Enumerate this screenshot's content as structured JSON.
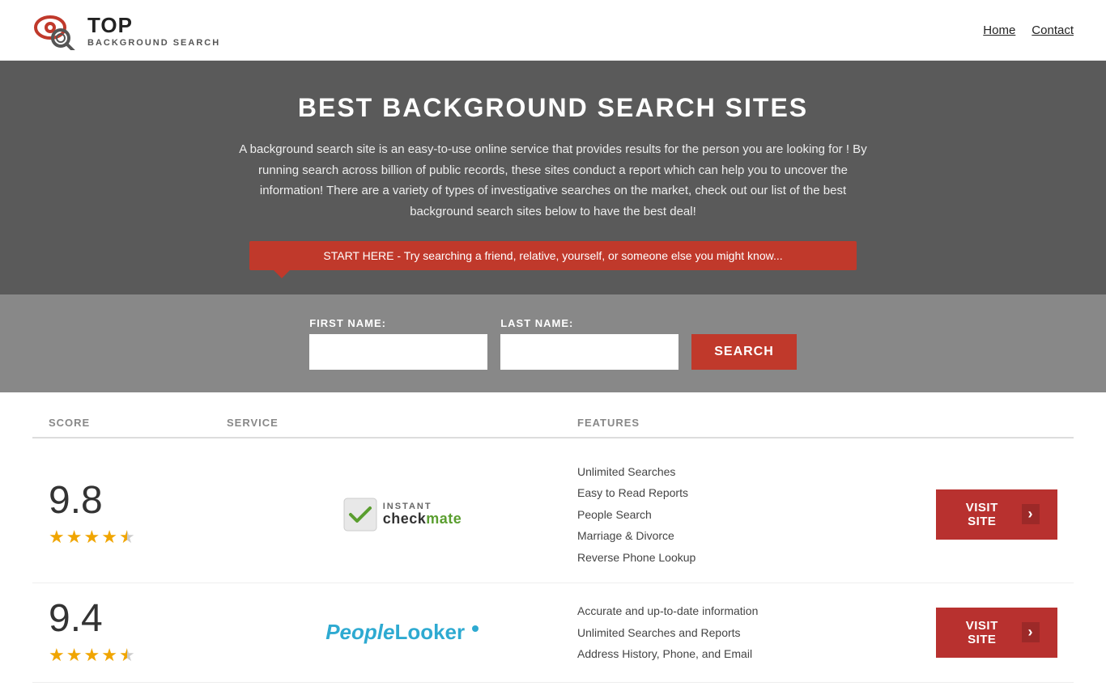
{
  "header": {
    "logo_top": "TOP",
    "logo_sub": "BACKGROUND SEARCH",
    "nav": [
      {
        "label": "Home",
        "href": "#"
      },
      {
        "label": "Contact",
        "href": "#"
      }
    ]
  },
  "hero": {
    "title": "BEST BACKGROUND SEARCH SITES",
    "description": "A background search site is an easy-to-use online service that provides results  for the person you are looking for ! By  running  search across billion of public records, these sites conduct  a report which can help you to uncover the information! There are a variety of types of investigative searches on the market, check out our  list of the best background search sites below to have the best deal!",
    "search_banner": "START HERE - Try searching a friend, relative, yourself, or someone else you might know..."
  },
  "search_form": {
    "first_name_label": "FIRST NAME:",
    "last_name_label": "LAST NAME:",
    "button_label": "SEARCH",
    "first_name_placeholder": "",
    "last_name_placeholder": ""
  },
  "table": {
    "headers": {
      "score": "SCORE",
      "service": "SERVICE",
      "features": "FEATURES",
      "action": ""
    },
    "rows": [
      {
        "score": "9.8",
        "stars": 4.5,
        "service_name": "instantcheckmate",
        "service_display": "instant checkmate",
        "features": [
          "Unlimited Searches",
          "Easy to Read Reports",
          "People Search",
          "Marriage & Divorce",
          "Reverse Phone Lookup"
        ],
        "visit_label": "VISIT SITE"
      },
      {
        "score": "9.4",
        "stars": 4.5,
        "service_name": "peoplelooker",
        "service_display": "PeopleLooker",
        "features": [
          "Accurate and up-to-date information",
          "Unlimited Searches and Reports",
          "Address History, Phone, and Email"
        ],
        "visit_label": "VISIT SITE"
      }
    ]
  },
  "colors": {
    "red": "#c0392b",
    "dark_red": "#b8312f",
    "star_gold": "#f0a500",
    "score_color": "#333",
    "header_bg": "#fff",
    "hero_bg": "#5a5a5a",
    "search_form_bg": "#888888"
  }
}
